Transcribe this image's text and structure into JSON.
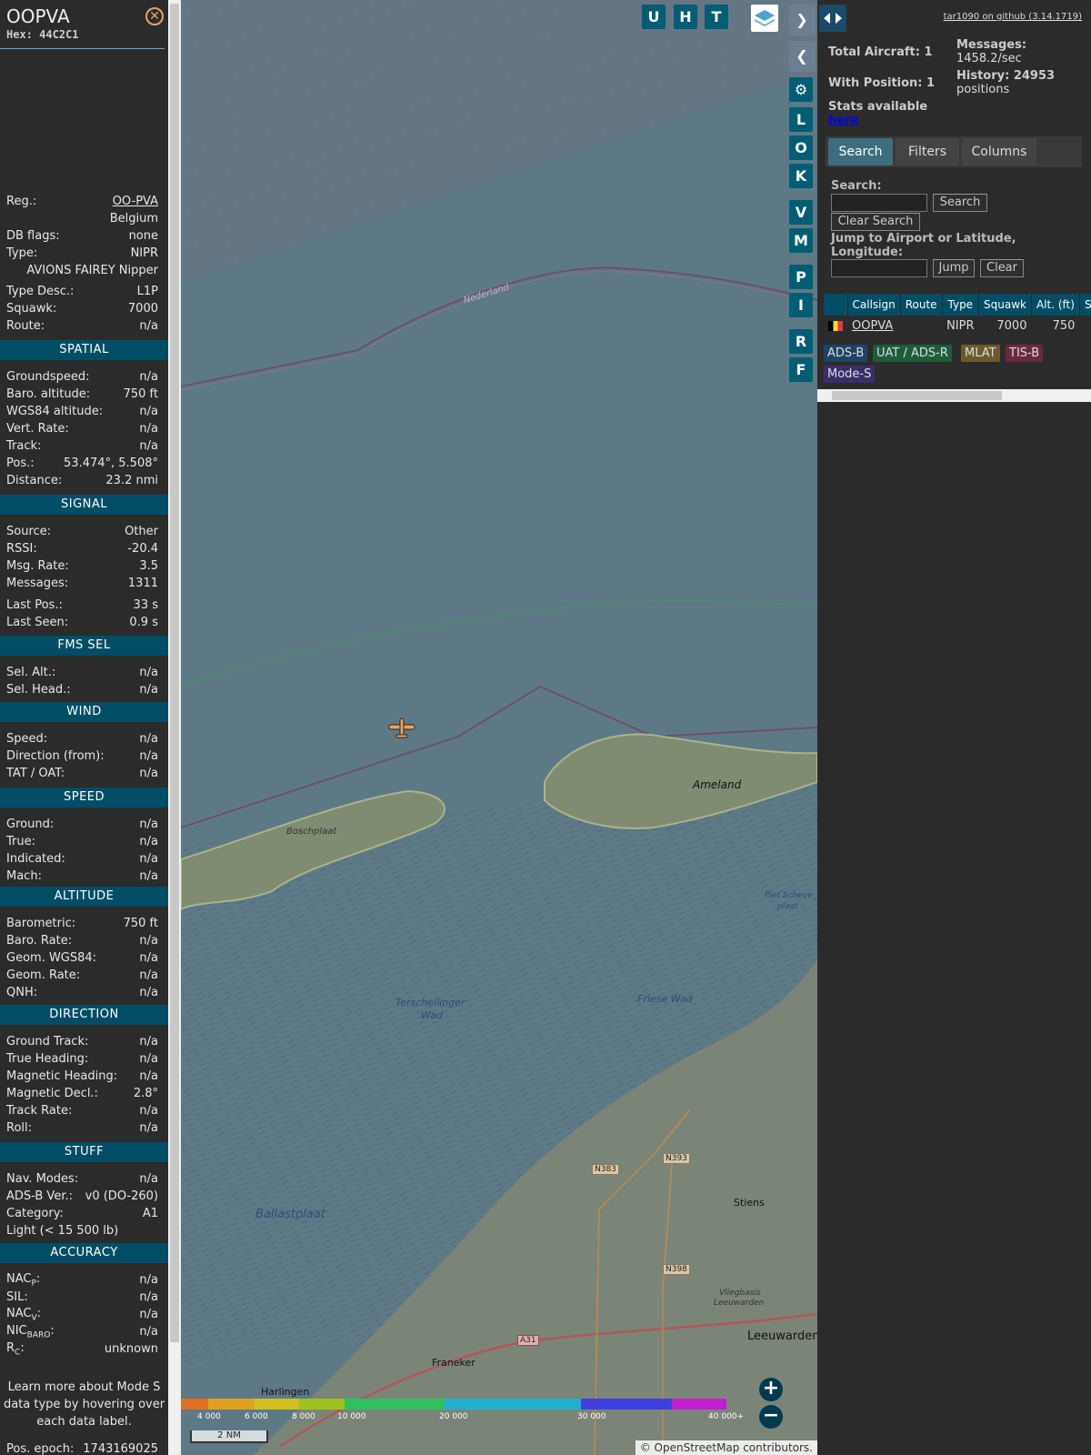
{
  "aircraft": {
    "callsign": "OOPVA",
    "hex_label": "Hex: 44C2C1",
    "close_icon": "close-circle-icon",
    "reg_label": "Reg.:",
    "reg_value": "OO-PVA",
    "country": "Belgium",
    "dbflags_label": "DB flags:",
    "dbflags_value": "none",
    "type_label": "Type:",
    "type_value": "NIPR",
    "type_full": "AVIONS FAIREY Nipper",
    "typedesc_label": "Type Desc.:",
    "typedesc_value": "L1P",
    "squawk_label": "Squawk:",
    "squawk_value": "7000",
    "route_label": "Route:",
    "route_value": "n/a"
  },
  "sections": {
    "spatial": {
      "title": "SPATIAL",
      "rows": [
        {
          "k": "Groundspeed:",
          "v": "n/a"
        },
        {
          "k": "Baro. altitude:",
          "v": "750 ft"
        },
        {
          "k": "WGS84 altitude:",
          "v": "n/a"
        },
        {
          "k": "Vert. Rate:",
          "v": "n/a"
        },
        {
          "k": "Track:",
          "v": "n/a"
        },
        {
          "k": "Pos.:",
          "v": "53.474°, 5.508°"
        },
        {
          "k": "Distance:",
          "v": "23.2 nmi"
        }
      ]
    },
    "signal": {
      "title": "SIGNAL",
      "rows": [
        {
          "k": "Source:",
          "v": "Other"
        },
        {
          "k": "RSSI:",
          "v": "-20.4"
        },
        {
          "k": "Msg. Rate:",
          "v": "3.5"
        },
        {
          "k": "Messages:",
          "v": "1311"
        },
        {
          "k": "Last Pos.:",
          "v": "33 s"
        },
        {
          "k": "Last Seen:",
          "v": "0.9 s"
        }
      ]
    },
    "fms": {
      "title": "FMS SEL",
      "rows": [
        {
          "k": "Sel. Alt.:",
          "v": "n/a"
        },
        {
          "k": "Sel. Head.:",
          "v": "n/a"
        }
      ]
    },
    "wind": {
      "title": "WIND",
      "rows": [
        {
          "k": "Speed:",
          "v": "n/a"
        },
        {
          "k": "Direction (from):",
          "v": "n/a"
        },
        {
          "k": "TAT / OAT:",
          "v": "n/a"
        }
      ]
    },
    "speed": {
      "title": "SPEED",
      "rows": [
        {
          "k": "Ground:",
          "v": "n/a"
        },
        {
          "k": "True:",
          "v": "n/a"
        },
        {
          "k": "Indicated:",
          "v": "n/a"
        },
        {
          "k": "Mach:",
          "v": "n/a"
        }
      ]
    },
    "altitude": {
      "title": "ALTITUDE",
      "rows": [
        {
          "k": "Barometric:",
          "v": "750 ft"
        },
        {
          "k": "Baro. Rate:",
          "v": "n/a"
        },
        {
          "k": "Geom. WGS84:",
          "v": "n/a"
        },
        {
          "k": "Geom. Rate:",
          "v": "n/a"
        },
        {
          "k": "QNH:",
          "v": "n/a"
        }
      ]
    },
    "direction": {
      "title": "DIRECTION",
      "rows": [
        {
          "k": "Ground Track:",
          "v": "n/a"
        },
        {
          "k": "True Heading:",
          "v": "n/a"
        },
        {
          "k": "Magnetic Heading:",
          "v": "n/a"
        },
        {
          "k": "Magnetic Decl.:",
          "v": "2.8°"
        },
        {
          "k": "Track Rate:",
          "v": "n/a"
        },
        {
          "k": "Roll:",
          "v": "n/a"
        }
      ]
    },
    "stuff": {
      "title": "STUFF",
      "rows": [
        {
          "k": "Nav. Modes:",
          "v": "n/a"
        },
        {
          "k": "ADS-B Ver.:",
          "v": "v0 (DO-260)"
        },
        {
          "k": "Category:",
          "v": "A1"
        },
        {
          "k": "Light (< 15 500 lb)",
          "v": ""
        }
      ]
    },
    "accuracy": {
      "title": "ACCURACY",
      "rows": [
        {
          "k": "NAC",
          "sub": "P",
          "v": "n/a"
        },
        {
          "k": "SIL:",
          "v": "n/a"
        },
        {
          "k": "NAC",
          "sub": "V",
          "v": "n/a"
        },
        {
          "k": "NIC",
          "sub": "BARO",
          "v": "n/a"
        },
        {
          "k": "R",
          "sub": "C",
          "v": "unknown"
        }
      ]
    }
  },
  "learn_more": "Learn more about Mode S data type by hovering over each data label.",
  "pos_epoch_label": "Pos. epoch:",
  "pos_epoch_value": "1743169025",
  "map": {
    "buttons_top": [
      "U",
      "H",
      "T"
    ],
    "side_buttons": [
      "L",
      "O",
      "K",
      "V",
      "M",
      "P",
      "I",
      "R",
      "F"
    ],
    "place_labels": {
      "nederland": "Nederland",
      "ameland": "Ameland",
      "boschplaat": "Boschplaat",
      "piet": "Piet Scheve",
      "piet2": "plaat",
      "terschellinger": "Terschellinger",
      "wad": "Wad",
      "friese": "Friese Wad",
      "ballastplaat": "Ballastplaat",
      "stiens": "Stiens",
      "leeuwarden": "Leeuwarden",
      "vlieg1": "Vliegbasis",
      "vlieg2": "Leeuwarden",
      "franeker": "Franeker",
      "harlingen": "Harlingen",
      "n383": "N383",
      "n393": "N393",
      "n398": "N398",
      "a31": "A31"
    },
    "altitude_ticks": [
      "4 000",
      "6 000",
      "8 000",
      "10 000",
      "20 000",
      "30 000",
      "40 000+"
    ],
    "scale_label": "2 NM",
    "attribution": "© OpenStreetMap contributors.",
    "colors": {
      "water": "#5e7986",
      "land": "#7a8578",
      "accent": "#005d73"
    }
  },
  "right": {
    "version_link": "tar1090 on github (3.14.1719)",
    "total_aircraft": "Total Aircraft: 1",
    "with_position": "With Position: 1",
    "messages_label": "Messages:",
    "messages_value": "1458.2/sec",
    "history_label": "History: 24953",
    "history_value": "positions",
    "stats_label": "Stats available",
    "stats_link": "here",
    "tabs": [
      "Search",
      "Filters",
      "Columns"
    ],
    "search_label": "Search:",
    "search_button": "Search",
    "clear_search_button": "Clear Search",
    "jump_label": "Jump to Airport or Latitude, Longitude:",
    "jump_button": "Jump",
    "clear_button": "Clear",
    "table_headers": [
      "",
      "Callsign",
      "Route",
      "Type",
      "Squawk",
      "Alt. (ft)",
      "Spd."
    ],
    "table_row": {
      "callsign": "OOPVA",
      "route": "",
      "type": "NIPR",
      "squawk": "7000",
      "alt": "750",
      "spd": ""
    },
    "sources": [
      "ADS-B",
      "UAT / ADS-R",
      "MLAT",
      "TIS-B",
      "Mode-S"
    ]
  }
}
